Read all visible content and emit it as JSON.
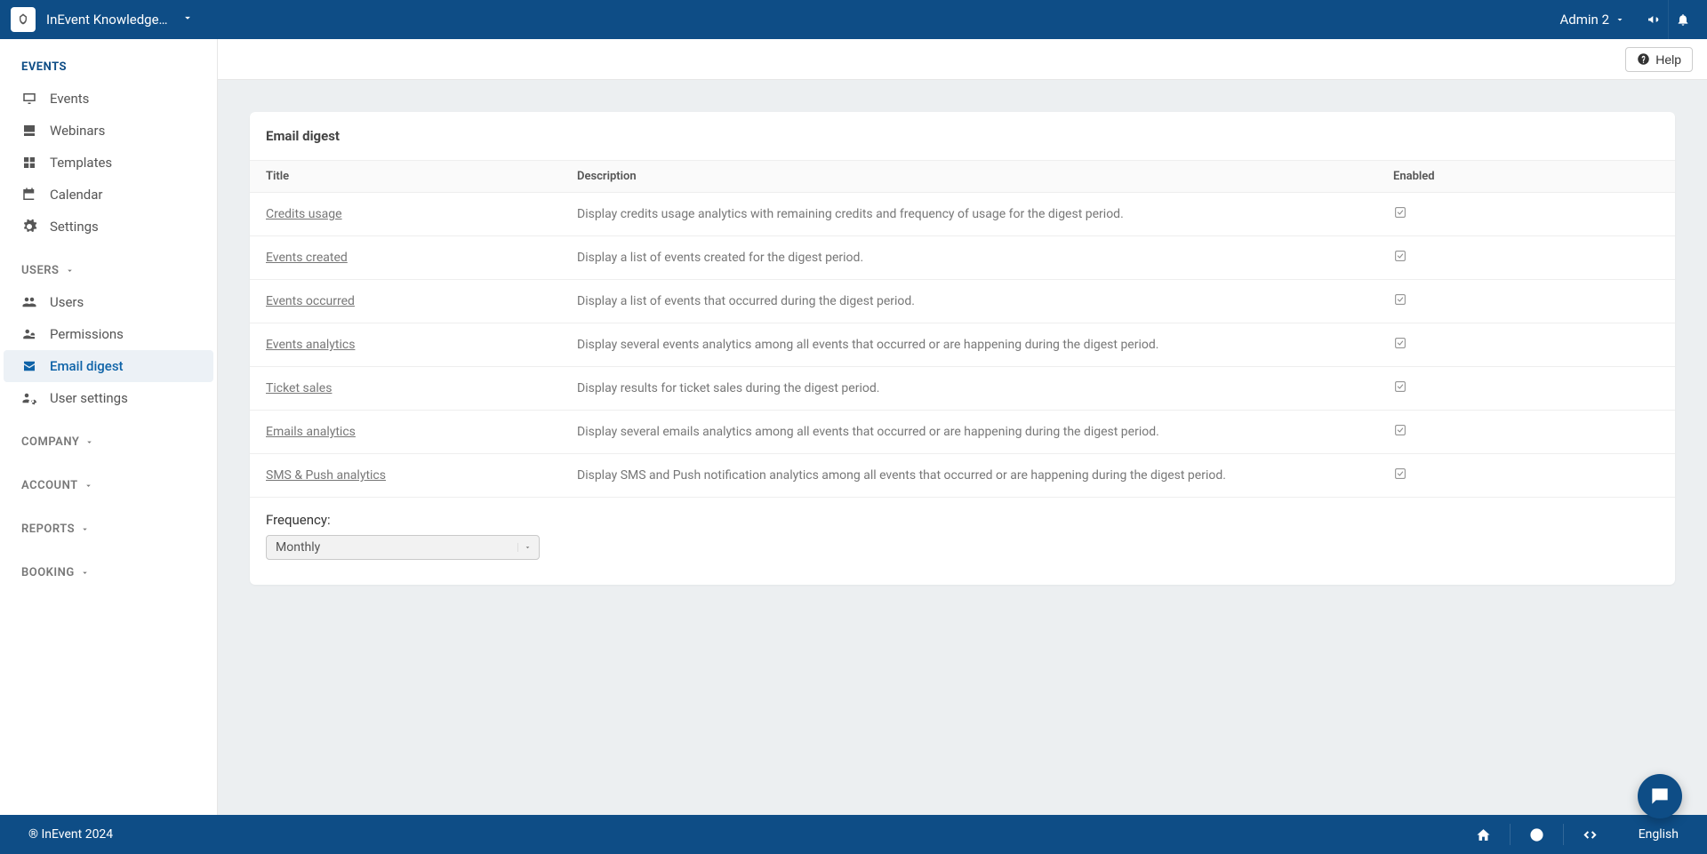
{
  "header": {
    "brand_title": "InEvent Knowledge ...",
    "user_label": "Admin 2"
  },
  "sidebar": {
    "sections": {
      "events": {
        "label": "EVENTS"
      },
      "users": {
        "label": "USERS"
      },
      "company": {
        "label": "COMPANY"
      },
      "account": {
        "label": "ACCOUNT"
      },
      "reports": {
        "label": "REPORTS"
      },
      "booking": {
        "label": "BOOKING"
      }
    },
    "events_items": {
      "events": "Events",
      "webinars": "Webinars",
      "templates": "Templates",
      "calendar": "Calendar",
      "settings": "Settings"
    },
    "users_items": {
      "users": "Users",
      "permissions": "Permissions",
      "email_digest": "Email digest",
      "user_settings": "User settings"
    }
  },
  "toolbar": {
    "help_label": "Help"
  },
  "card": {
    "title": "Email digest",
    "columns": {
      "title": "Title",
      "description": "Description",
      "enabled": "Enabled"
    },
    "rows": [
      {
        "title": "Credits usage",
        "description": "Display credits usage analytics with remaining credits and frequency of usage for the digest period.",
        "enabled": true
      },
      {
        "title": "Events created",
        "description": "Display a list of events created for the digest period.",
        "enabled": true
      },
      {
        "title": "Events occurred",
        "description": "Display a list of events that occurred during the digest period.",
        "enabled": true
      },
      {
        "title": "Events analytics",
        "description": "Display several events analytics among all events that occurred or are happening during the digest period.",
        "enabled": true
      },
      {
        "title": "Ticket sales",
        "description": "Display results for ticket sales during the digest period.",
        "enabled": true
      },
      {
        "title": "Emails analytics",
        "description": "Display several emails analytics among all events that occurred or are happening during the digest period.",
        "enabled": true
      },
      {
        "title": "SMS & Push analytics",
        "description": "Display SMS and Push notification analytics among all events that occurred or are happening during the digest period.",
        "enabled": true
      }
    ],
    "frequency_label": "Frequency:",
    "frequency_value": "Monthly"
  },
  "footer": {
    "copyright": "® InEvent 2024",
    "language": "English"
  }
}
